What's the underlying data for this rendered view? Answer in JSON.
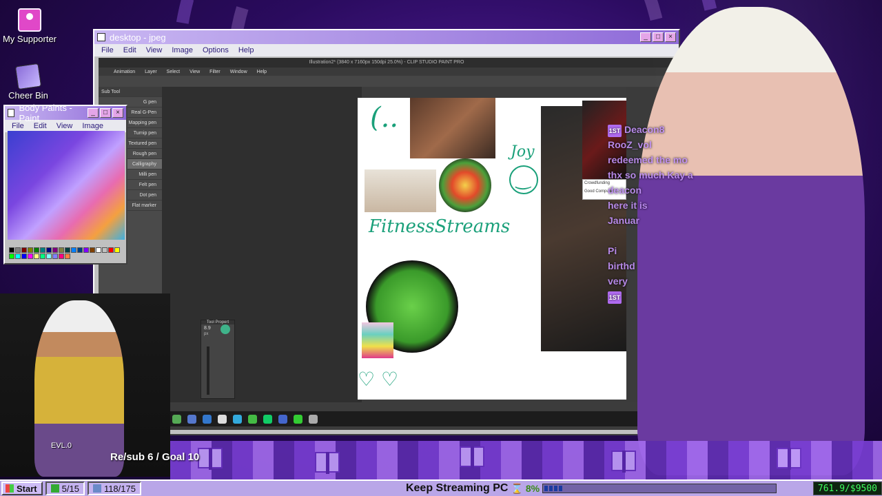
{
  "desktop": {
    "icons": [
      {
        "label": "My Supporter",
        "icon": "user-icon"
      },
      {
        "label": "Cheer Bin",
        "icon": "bin-icon"
      }
    ]
  },
  "viewer": {
    "title": "desktop - jpeg",
    "menu": [
      "File",
      "Edit",
      "View",
      "Image",
      "Options",
      "Help"
    ]
  },
  "clip_studio": {
    "title": "Illustration2* (3840 x 7160px 150dpi 25.0%) - CLIP STUDIO PAINT PRO",
    "menu": [
      "Animation",
      "Layer",
      "Select",
      "View",
      "Filter",
      "Window",
      "Help"
    ],
    "sub_tool": "Sub Tool",
    "brushes": [
      "G pen",
      "Real G-Pen",
      "Mapping pen",
      "Turnip pen",
      "Textured pen",
      "Rough pen",
      "Calligraphy",
      "Milli pen",
      "Felt pen",
      "Dot pen",
      "Flat marker"
    ],
    "selected_brush": "Calligraphy",
    "canvas_text": [
      "Joy",
      "FitnessStreams"
    ],
    "tool_popup_value": "8.9",
    "tool_popup_unit": "px",
    "tool_popup_title": "Tool Propert",
    "card_title": "Crowdfunding",
    "card_caption": "Good Computer |"
  },
  "paint": {
    "title": "Body Paints - Paint",
    "menu": [
      "File",
      "Edit",
      "View",
      "Image"
    ],
    "colors": [
      "#000000",
      "#808080",
      "#800000",
      "#808000",
      "#008000",
      "#008080",
      "#000080",
      "#800080",
      "#808040",
      "#004040",
      "#0080ff",
      "#004080",
      "#8000ff",
      "#804000",
      "#ffffff",
      "#c0c0c0",
      "#ff0000",
      "#ffff00",
      "#00ff00",
      "#00ffff",
      "#0000ff",
      "#ff00ff",
      "#ffff80",
      "#00ff80",
      "#80ffff",
      "#8080ff",
      "#ff0080",
      "#ff8040"
    ]
  },
  "chat": {
    "lines": [
      {
        "badge": "1ST",
        "text": "Deacon8"
      },
      {
        "badge": "",
        "text": "RooZ_vol"
      },
      {
        "badge": "",
        "text": "redeemed the mo"
      },
      {
        "badge": "",
        "text": "thx so much Kay a"
      },
      {
        "badge": "",
        "text": "deacon"
      },
      {
        "badge": "",
        "text": "here it is"
      },
      {
        "badge": "",
        "text": "Januar"
      },
      {
        "badge": "",
        "text": ""
      },
      {
        "badge": "",
        "text": "Pi"
      },
      {
        "badge": "",
        "text": "birthd"
      },
      {
        "badge": "",
        "text": "very"
      },
      {
        "badge": "1ST",
        "text": ""
      }
    ]
  },
  "overlay": {
    "level": "EVL.0",
    "goal": "Re/sub 6 / Goal 10"
  },
  "taskbar": {
    "start": "Start",
    "subs": "5/15",
    "followers": "118/175",
    "keep_streaming": "Keep Streaming PC",
    "percent": "8%",
    "progress_fraction": 0.08,
    "money": "761.9/$9500"
  },
  "colors": {
    "accent": "#8e6ad8",
    "chat": "#c896ff",
    "money": "#40ff60"
  }
}
